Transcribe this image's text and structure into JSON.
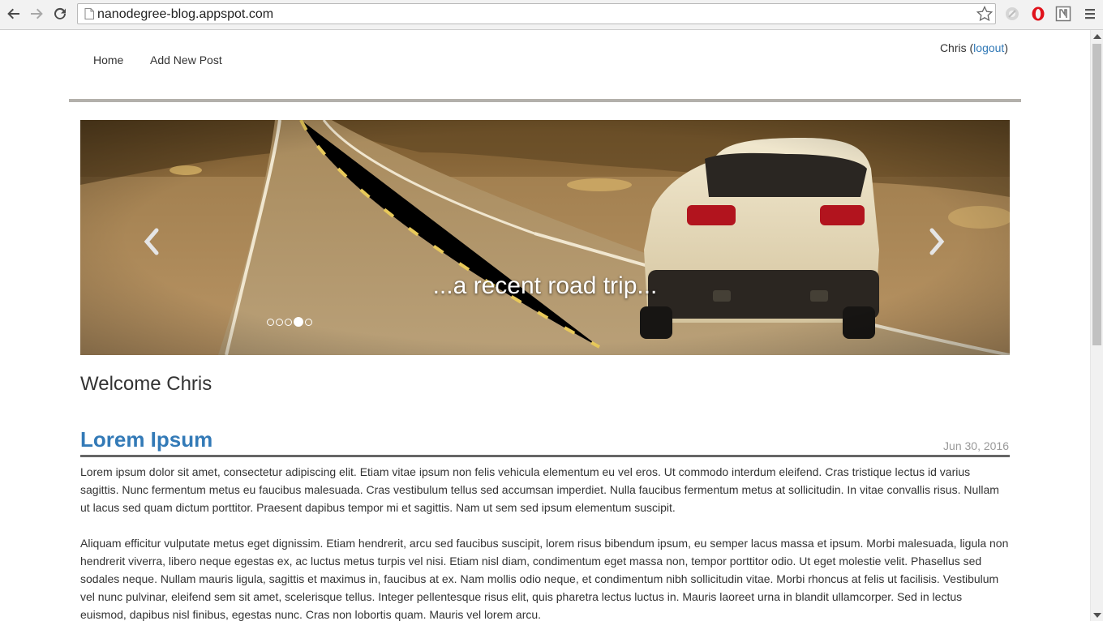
{
  "browser": {
    "url": "nanodegree-blog.appspot.com",
    "icons": [
      "back-icon",
      "forward-icon",
      "reload-icon",
      "page-icon",
      "bookmark-star-icon",
      "extension-icon",
      "opera-icon",
      "notion-icon",
      "menu-icon"
    ]
  },
  "nav": {
    "home": "Home",
    "add_post": "Add New Post"
  },
  "user": {
    "name": "Chris",
    "open_paren": " (",
    "logout": "logout",
    "close_paren": ")"
  },
  "carousel": {
    "caption": "...a recent road trip...",
    "indicator_count": 5,
    "active_index": 3
  },
  "welcome": "Welcome Chris",
  "post": {
    "title": "Lorem Ipsum",
    "date": "Jun 30, 2016",
    "paragraphs": [
      "Lorem ipsum dolor sit amet, consectetur adipiscing elit. Etiam vitae ipsum non felis vehicula elementum eu vel eros. Ut commodo interdum eleifend. Cras tristique lectus id varius sagittis. Nunc fermentum metus eu faucibus malesuada. Cras vestibulum tellus sed accumsan imperdiet. Nulla faucibus fermentum metus at sollicitudin. In vitae convallis risus. Nullam ut lacus sed quam dictum porttitor. Praesent dapibus tempor mi et sagittis. Nam ut sem sed ipsum elementum suscipit.",
      "Aliquam efficitur vulputate metus eget dignissim. Etiam hendrerit, arcu sed faucibus suscipit, lorem risus bibendum ipsum, eu semper lacus massa et ipsum. Morbi malesuada, ligula non hendrerit viverra, libero neque egestas ex, ac luctus metus turpis vel nisi. Etiam nisl diam, condimentum eget massa non, tempor porttitor odio. Ut eget molestie velit. Phasellus sed sodales neque. Nullam mauris ligula, sagittis et maximus in, faucibus at ex. Nam mollis odio neque, et condimentum nibh sollicitudin vitae. Morbi rhoncus at felis ut facilisis. Vestibulum vel nunc pulvinar, eleifend sem sit amet, scelerisque tellus. Integer pellentesque risus elit, quis pharetra lectus luctus in. Mauris laoreet urna in blandit ullamcorper. Sed in lectus euismod, dapibus nisl finibus, egestas nunc. Cras non lobortis quam. Mauris vel lorem arcu."
    ]
  },
  "colors": {
    "link": "#337ab7",
    "text": "#333333",
    "date": "#999999",
    "rule": "#b3b0ab"
  }
}
